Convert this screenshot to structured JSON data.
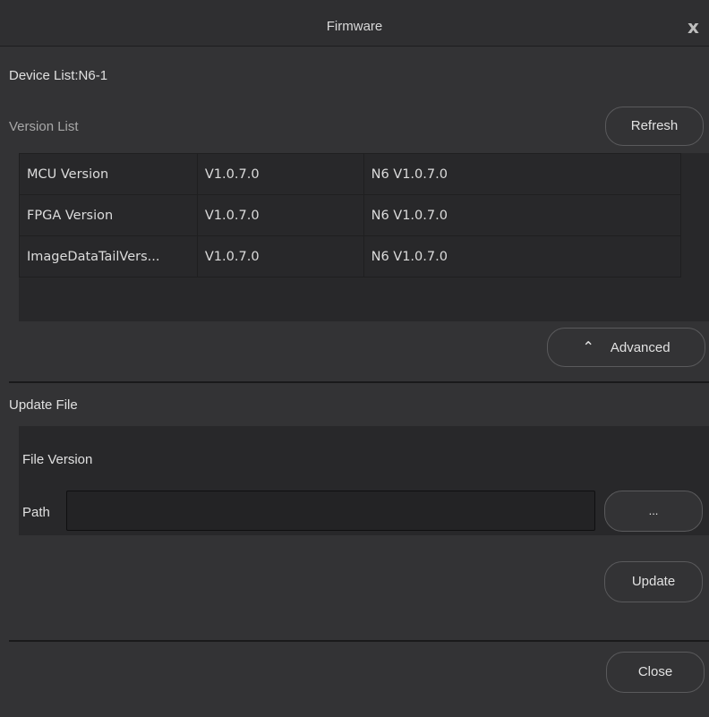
{
  "window": {
    "title": "Firmware",
    "close_glyph": "x"
  },
  "device": {
    "label": "Device List:N6-1"
  },
  "versions": {
    "section_label": "Version List",
    "refresh_label": "Refresh",
    "rows": [
      {
        "name": "MCU Version",
        "version": "V1.0.7.0",
        "full": "N6 V1.0.7.0"
      },
      {
        "name": "FPGA Version",
        "version": "V1.0.7.0",
        "full": "N6 V1.0.7.0"
      },
      {
        "name": "ImageDataTailVers...",
        "version": "V1.0.7.0",
        "full": "N6 V1.0.7.0"
      }
    ],
    "advanced_label": "Advanced",
    "advanced_icon": "double-chevron-up-icon"
  },
  "update": {
    "section_label": "Update File",
    "file_version_label": "File Version",
    "path_label": "Path",
    "path_value": "",
    "browse_label": "...",
    "update_label": "Update"
  },
  "footer": {
    "close_label": "Close"
  }
}
